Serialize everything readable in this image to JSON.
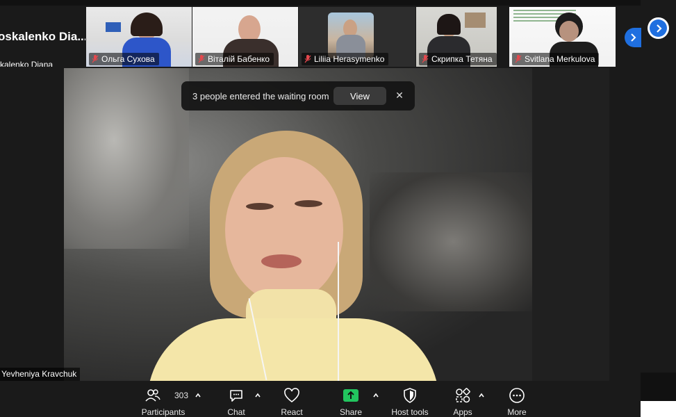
{
  "strip": {
    "first_tile": {
      "name_large": "oskalenko  Dia...",
      "name_small": "kalenko Diana"
    },
    "tiles": [
      {
        "name": "Ольга Сухова",
        "muted": true
      },
      {
        "name": "Віталій Бабенко",
        "muted": true
      },
      {
        "name": "Liliia Herasymenko",
        "muted": true
      },
      {
        "name": "Скрипка Тетяна",
        "muted": true
      },
      {
        "name": "Svitlana Merkulova",
        "muted": true
      }
    ]
  },
  "banner": {
    "message": "3 people entered the waiting room",
    "view_label": "View",
    "close_glyph": "✕"
  },
  "main": {
    "speaker_name": "Yevheniya Kravchuk"
  },
  "toolbar": {
    "participants_label": "Participants",
    "participants_count": "303",
    "chat_label": "Chat",
    "react_label": "React",
    "share_label": "Share",
    "host_tools_label": "Host tools",
    "apps_label": "Apps",
    "more_label": "More"
  },
  "colors": {
    "accent_blue": "#1f6fe0",
    "share_green": "#22c55e",
    "muted_red": "#e5484d"
  }
}
